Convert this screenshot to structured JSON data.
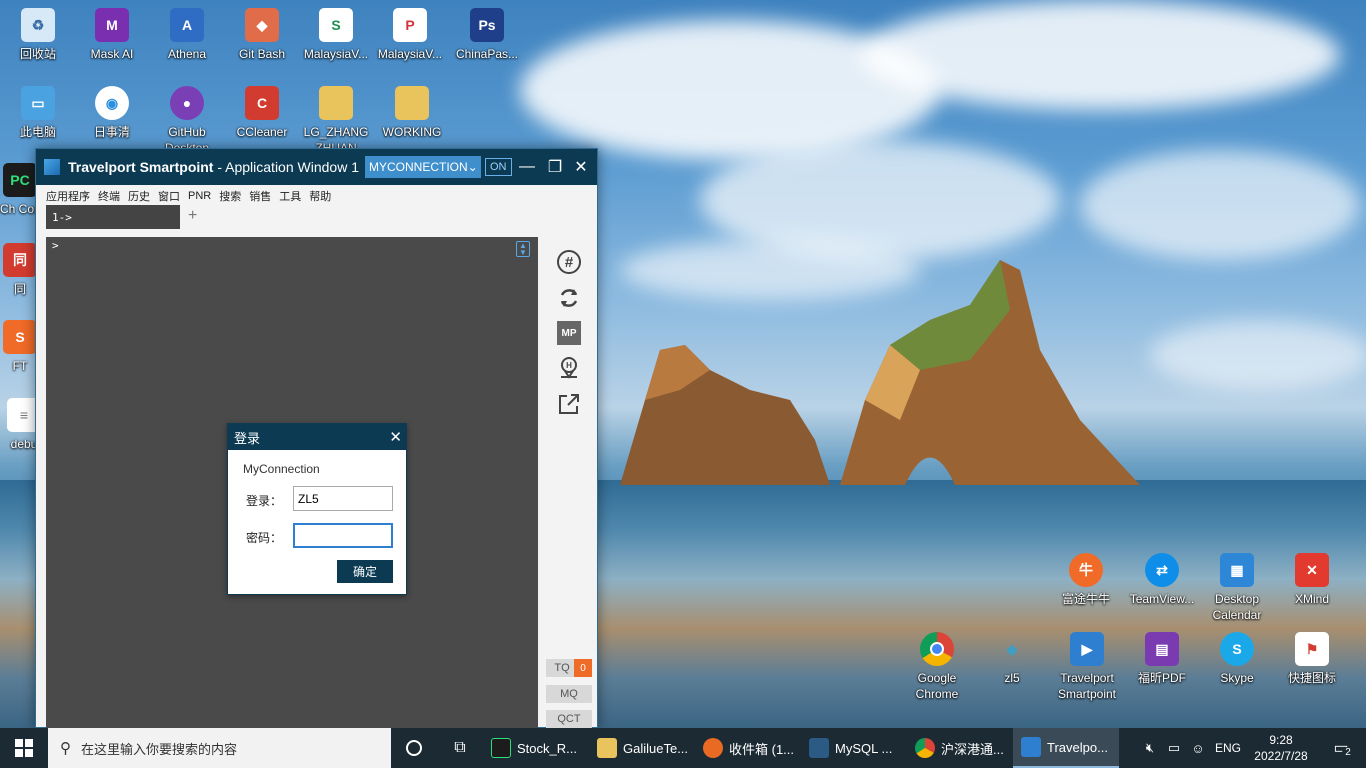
{
  "desktop_icons": [
    {
      "label": "回收站",
      "icon": "recycle-bin-icon",
      "color": "#6fb3e8"
    },
    {
      "label": "Mask AI",
      "icon": "mask-ai-icon",
      "color": "#7a2fb0"
    },
    {
      "label": "Athena",
      "icon": "athena-icon",
      "color": "#2f6cc4"
    },
    {
      "label": "Git Bash",
      "icon": "git-bash-icon",
      "color": "#e06c4a"
    },
    {
      "label": "MalaysiaV...",
      "icon": "excel-file-icon",
      "color": "#1e8e4f"
    },
    {
      "label": "MalaysiaV...",
      "icon": "pdf-file-icon",
      "color": "#d4343d"
    },
    {
      "label": "ChinaPas...",
      "icon": "photoshop-file-icon",
      "color": "#1f3f8a"
    },
    {
      "label": "此电脑",
      "icon": "this-pc-icon",
      "color": "#4aa3e0"
    },
    {
      "label": "日事清",
      "icon": "rishiqing-icon",
      "color": "#2a8fe0"
    },
    {
      "label": "GitHub Desktop",
      "icon": "github-desktop-icon",
      "color": "#7b3fb5"
    },
    {
      "label": "CCleaner",
      "icon": "ccleaner-icon",
      "color": "#d23b2f"
    },
    {
      "label": "LG_ZHANG ZHUAN",
      "icon": "folder-icon",
      "color": "#e9c35b"
    },
    {
      "label": "WORKING",
      "icon": "folder-icon",
      "color": "#e9c35b"
    },
    {
      "label": "PyCh Comm",
      "icon": "pycharm-icon",
      "color": "#1c1c1c"
    },
    {
      "label": "同",
      "icon": "app-icon",
      "color": "#d23b2f"
    },
    {
      "label": "FT",
      "icon": "futu-icon",
      "color": "#f06a28"
    },
    {
      "label": "debu",
      "icon": "text-file-icon",
      "color": "#ffffff"
    },
    {
      "label": "富途牛牛",
      "icon": "futu-icon",
      "color": "#f06a28"
    },
    {
      "label": "TeamView...",
      "icon": "teamviewer-icon",
      "color": "#0e8ee9"
    },
    {
      "label": "Desktop Calendar",
      "icon": "calendar-icon",
      "color": "#2e86d6"
    },
    {
      "label": "XMind",
      "icon": "xmind-icon",
      "color": "#e23a2e"
    },
    {
      "label": "Google Chrome",
      "icon": "chrome-icon",
      "color": "#4285f4"
    },
    {
      "label": "zl5",
      "icon": "zl5-icon",
      "color": "#3aa0c8"
    },
    {
      "label": "Travelport Smartpoint",
      "icon": "travelport-icon",
      "color": "#2f7fd0"
    },
    {
      "label": "福昕PDF",
      "icon": "foxit-icon",
      "color": "#7a3bb0"
    },
    {
      "label": "Skype",
      "icon": "skype-icon",
      "color": "#1ba8e8"
    },
    {
      "label": "快捷图标",
      "icon": "shortcut-icon",
      "color": "#e9c35b"
    }
  ],
  "app": {
    "title_bold": "Travelport Smartpoint",
    "title_rest": " - Application Window 1",
    "connection": "MYCONNECTION",
    "toggle": "ON",
    "menu": [
      "应用程序",
      "终端",
      "历史",
      "窗口",
      "PNR",
      "搜索",
      "销售",
      "工具",
      "帮助"
    ],
    "tab_label": "1->",
    "prompt": ">",
    "side_tools": [
      {
        "icon": "hashtag-icon"
      },
      {
        "icon": "refresh-icon"
      },
      {
        "icon": "mp-icon",
        "label": "MP"
      },
      {
        "icon": "location-pin-icon"
      },
      {
        "icon": "external-link-icon"
      }
    ],
    "queue": {
      "tq": "TQ",
      "tq_count": "0",
      "mq": "MQ",
      "qct": "QCT"
    }
  },
  "login": {
    "title": "登录",
    "connection": "MyConnection",
    "user_label": "登录：",
    "user_value": "ZL5",
    "password_label": "密码：",
    "password_value": "",
    "ok": "确定"
  },
  "taskbar": {
    "search_placeholder": "在这里输入你要搜索的内容",
    "apps": [
      {
        "label": "Stock_R...",
        "icon": "pycharm-icon",
        "color": "#1c1c1c"
      },
      {
        "label": "GaliluеTe...",
        "icon": "folder-icon",
        "color": "#e9c35b"
      },
      {
        "label": "收件箱 (1...",
        "icon": "thunderbird-icon",
        "color": "#e86a23"
      },
      {
        "label": "MySQL ...",
        "icon": "mysql-icon",
        "color": "#2b5b84"
      },
      {
        "label": "沪深港通...",
        "icon": "chrome-icon",
        "color": "#4285f4"
      },
      {
        "label": "Travelpo...",
        "icon": "travelport-icon",
        "color": "#2f7fd0"
      }
    ],
    "lang": "ENG",
    "time": "9:28",
    "date": "2022/7/28",
    "notifications": "2"
  },
  "colors": {
    "title_bar": "#0b3a52",
    "connection": "#3f8fcd",
    "terminal": "#4a4a4a",
    "taskbar": "#1c2a33"
  }
}
